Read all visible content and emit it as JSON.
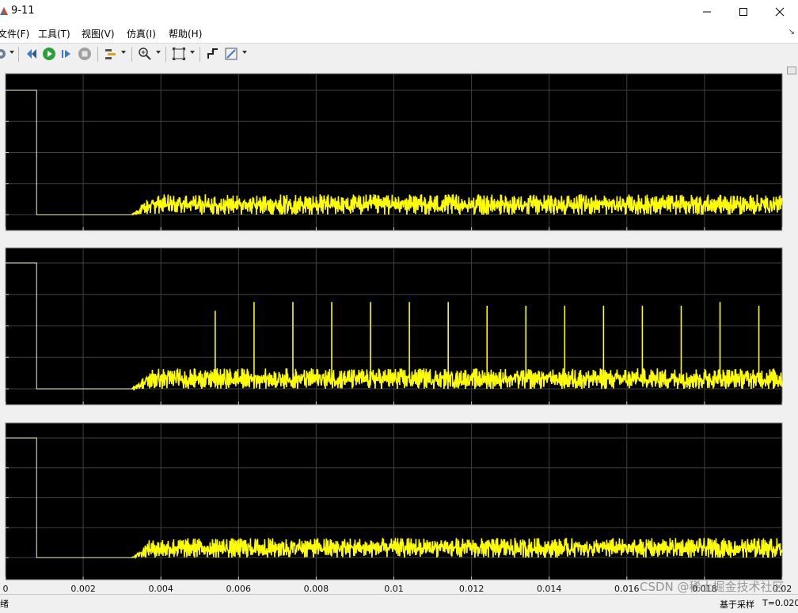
{
  "window": {
    "title": "9-11",
    "controls": {
      "minimize": "minimize-icon",
      "maximize": "maximize-icon",
      "close": "close-icon"
    }
  },
  "menu": {
    "items": [
      "文件(F)",
      "工具(T)",
      "视图(V)",
      "仿真(I)",
      "帮助(H)"
    ]
  },
  "toolbar": {
    "icons": [
      "settings-icon",
      "restore-layout-icon",
      "run-icon",
      "step-forward-icon",
      "stop-icon",
      "highlight-signal-icon",
      "zoom-in-icon",
      "fit-to-view-icon",
      "trigger-icon",
      "style-icon"
    ]
  },
  "colors": {
    "plot_bg": "#000000",
    "trace": "#ffff00",
    "grid": "#404040",
    "frame": "#f0f0f0"
  },
  "chart_data": [
    {
      "type": "line",
      "xlim": [
        0,
        0.02
      ],
      "xticks": [
        0,
        0.002,
        0.004,
        0.006,
        0.008,
        0.01,
        0.012,
        0.014,
        0.016,
        0.018,
        0.02
      ],
      "grid": true,
      "series": [
        {
          "step_high": 1,
          "step_high_until": 0.0008,
          "zero_until": 0.00325,
          "noise_mean": 0.08,
          "noise_amp": 0.06,
          "spikes": []
        }
      ]
    },
    {
      "type": "line",
      "xlim": [
        0,
        0.02
      ],
      "xticks": [
        0,
        0.002,
        0.004,
        0.006,
        0.008,
        0.01,
        0.012,
        0.014,
        0.016,
        0.018,
        0.02
      ],
      "grid": true,
      "series": [
        {
          "step_high": 1,
          "step_high_until": 0.0008,
          "zero_until": 0.00325,
          "noise_mean": 0.08,
          "noise_amp": 0.06,
          "spikes": [
            [
              0.0054,
              0.62
            ],
            [
              0.0064,
              0.69
            ],
            [
              0.0074,
              0.69
            ],
            [
              0.0084,
              0.69
            ],
            [
              0.0094,
              0.69
            ],
            [
              0.0104,
              0.69
            ],
            [
              0.0114,
              0.69
            ],
            [
              0.0124,
              0.66
            ],
            [
              0.0134,
              0.66
            ],
            [
              0.0144,
              0.66
            ],
            [
              0.0154,
              0.66
            ],
            [
              0.0164,
              0.66
            ],
            [
              0.0174,
              0.66
            ],
            [
              0.0184,
              0.69
            ],
            [
              0.0194,
              0.66
            ]
          ]
        }
      ]
    },
    {
      "type": "line",
      "xlim": [
        0,
        0.02
      ],
      "xticks": [
        0,
        0.002,
        0.004,
        0.006,
        0.008,
        0.01,
        0.012,
        0.014,
        0.016,
        0.018,
        0.02
      ],
      "grid": true,
      "series": [
        {
          "step_high": 1,
          "step_high_until": 0.0008,
          "zero_until": 0.00325,
          "noise_mean": 0.08,
          "noise_amp": 0.06,
          "spikes": []
        }
      ]
    }
  ],
  "x_tick_labels": [
    "0",
    "0.002",
    "0.004",
    "0.006",
    "0.008",
    "0.01",
    "0.012",
    "0.014",
    "0.016",
    "0.018",
    "0.02"
  ],
  "status": {
    "left": "绪",
    "mode": "基于采样",
    "time": "T=0.020"
  },
  "watermark": "CSDN @稀土掘金技术社区"
}
